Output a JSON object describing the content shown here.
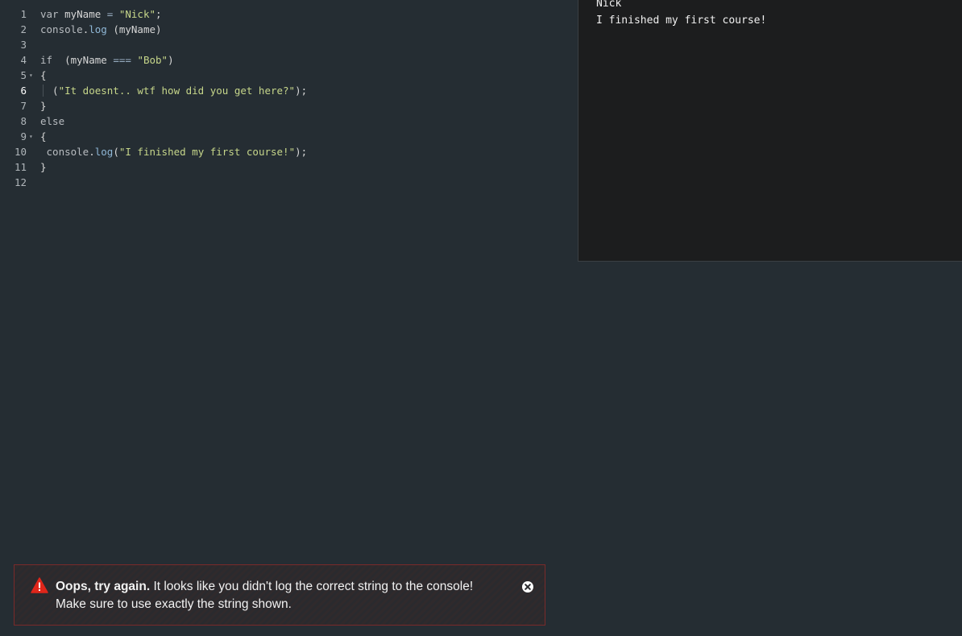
{
  "editor": {
    "lines": [
      {
        "n": "1",
        "parts": [
          {
            "t": "var ",
            "c": "kw"
          },
          {
            "t": "myName ",
            "c": ""
          },
          {
            "t": "= ",
            "c": "op"
          },
          {
            "t": "\"Nick\"",
            "c": "str"
          },
          {
            "t": ";",
            "c": ""
          }
        ]
      },
      {
        "n": "2",
        "parts": [
          {
            "t": "console",
            "c": "kw"
          },
          {
            "t": ".",
            "c": ""
          },
          {
            "t": "log",
            "c": "prop"
          },
          {
            "t": " (myName)",
            "c": ""
          }
        ]
      },
      {
        "n": "3",
        "parts": []
      },
      {
        "n": "4",
        "parts": [
          {
            "t": "if  ",
            "c": "kw"
          },
          {
            "t": "(myName ",
            "c": ""
          },
          {
            "t": "=== ",
            "c": "op"
          },
          {
            "t": "\"Bob\"",
            "c": "str"
          },
          {
            "t": ")",
            "c": ""
          }
        ]
      },
      {
        "n": "5",
        "fold": true,
        "parts": [
          {
            "t": "{",
            "c": ""
          }
        ]
      },
      {
        "n": "6",
        "active": true,
        "guide": true,
        "parts": [
          {
            "t": "  (",
            "c": ""
          },
          {
            "t": "\"It doesnt.. wtf how did you get here?\"",
            "c": "str"
          },
          {
            "t": ");",
            "c": ""
          }
        ]
      },
      {
        "n": "7",
        "parts": [
          {
            "t": "}",
            "c": ""
          }
        ]
      },
      {
        "n": "8",
        "parts": [
          {
            "t": "else",
            "c": "kw"
          }
        ]
      },
      {
        "n": "9",
        "fold": true,
        "parts": [
          {
            "t": "{",
            "c": ""
          }
        ]
      },
      {
        "n": "10",
        "parts": [
          {
            "t": " console",
            "c": "kw"
          },
          {
            "t": ".",
            "c": ""
          },
          {
            "t": "log",
            "c": "prop"
          },
          {
            "t": "(",
            "c": ""
          },
          {
            "t": "\"I finished my first course!\"",
            "c": "str"
          },
          {
            "t": ");",
            "c": ""
          }
        ]
      },
      {
        "n": "11",
        "parts": [
          {
            "t": "}",
            "c": ""
          }
        ]
      },
      {
        "n": "12",
        "parts": []
      }
    ]
  },
  "console": {
    "output": [
      "Nick",
      "I finished my first course!"
    ]
  },
  "alert": {
    "title": "Oops, try again.",
    "message": " It looks like you didn't log the correct string to the console! Make sure to use exactly the string shown.",
    "icon": "warning-icon",
    "close_icon": "close-icon",
    "accent_color": "#e0261a"
  }
}
